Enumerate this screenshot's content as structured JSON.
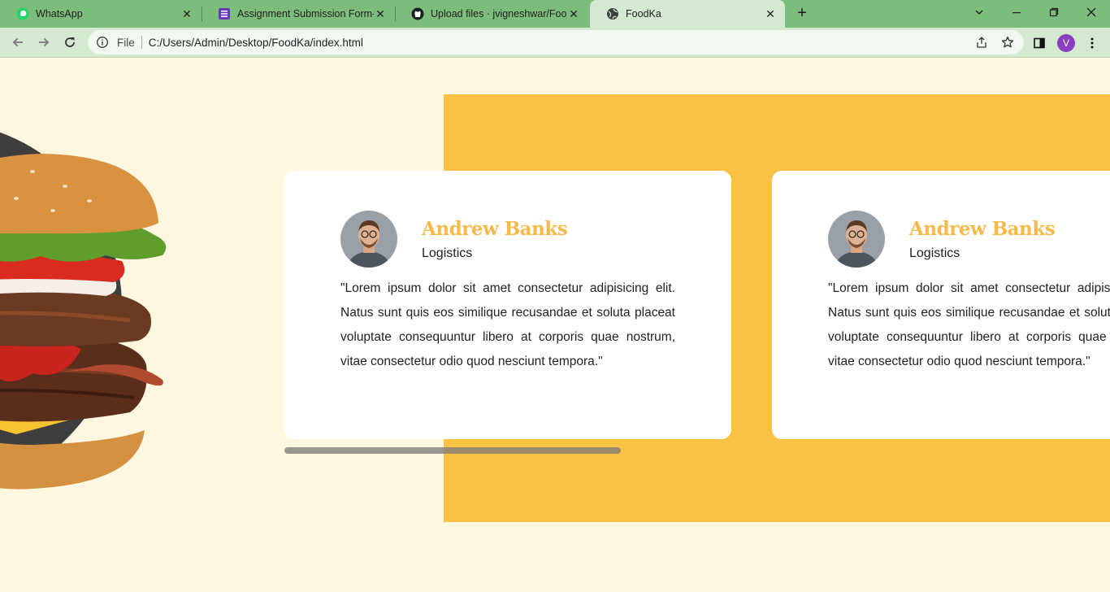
{
  "browser": {
    "tabs": [
      {
        "title": "WhatsApp",
        "icon": "whatsapp-icon",
        "active": false
      },
      {
        "title": "Assignment Submission Form-W",
        "icon": "forms-icon",
        "active": false
      },
      {
        "title": "Upload files · jvigneshwar/FoodK",
        "icon": "github-icon",
        "active": false
      },
      {
        "title": "FoodKa",
        "icon": "globe-icon",
        "active": true
      }
    ],
    "address": {
      "scheme_label": "File",
      "url": "C:/Users/Admin/Desktop/FoodKa/index.html"
    },
    "profile_initial": "V"
  },
  "testimonials": [
    {
      "name": "Andrew Banks",
      "role": "Logistics",
      "quote": "\"Lorem ipsum dolor sit amet consectetur adipisicing elit. Natus sunt quis eos similique recusandae et soluta placeat voluptate consequuntur libero at corporis quae nostrum, vitae consectetur odio quod nesciunt tempora.\""
    },
    {
      "name": "Andrew Banks",
      "role": "Logistics",
      "quote": "\"Lorem ipsum dolor sit amet consectetur adipisicing elit. Natus sunt quis eos similique recusandae et soluta placeat voluptate consequuntur libero at corporis quae nostrum, vitae consectetur odio quod nesciunt tempora.\""
    }
  ],
  "colors": {
    "tabbar": "#7dbd7c",
    "toolbar": "#d3ead0",
    "page_bg": "#fff7e0",
    "accent_yellow": "#fbc144",
    "name_color": "#f8b94a"
  }
}
